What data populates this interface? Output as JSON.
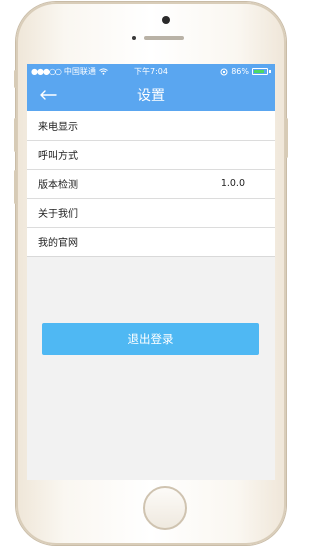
{
  "status_bar": {
    "signal": "●●●○○",
    "carrier": "中国联通",
    "wifi_icon": "wifi-icon",
    "time": "下午7:04",
    "battery_percent": "86%",
    "battery_level": 0.86
  },
  "nav": {
    "title": "设置",
    "back_icon": "back-arrow-icon"
  },
  "settings": {
    "items": [
      {
        "label": "来电显示",
        "value": ""
      },
      {
        "label": "呼叫方式",
        "value": ""
      },
      {
        "label": "版本检测",
        "value": "1.0.0"
      },
      {
        "label": "关于我们",
        "value": ""
      },
      {
        "label": "我的官网",
        "value": ""
      }
    ]
  },
  "logout": {
    "label": "退出登录"
  },
  "colors": {
    "header": "#5aa6f0",
    "button": "#4fb8f3",
    "background": "#f2f2f2"
  }
}
